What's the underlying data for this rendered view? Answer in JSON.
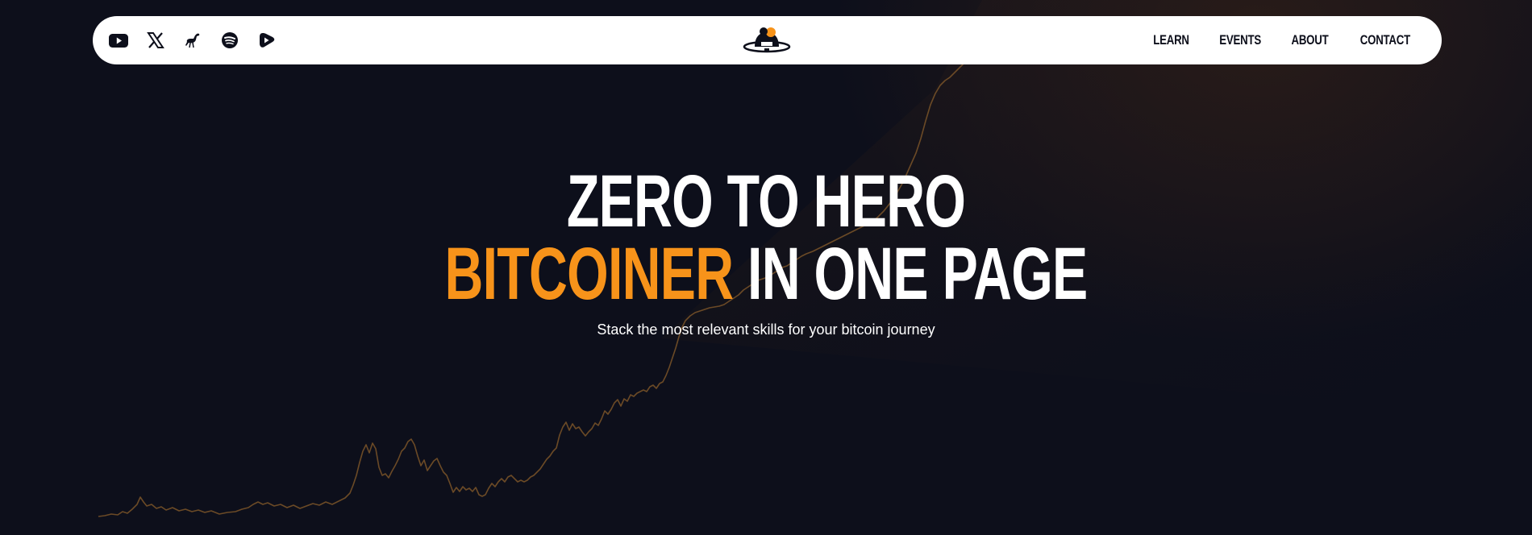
{
  "nav": {
    "social": [
      {
        "name": "youtube-icon",
        "label": "YouTube"
      },
      {
        "name": "x-icon",
        "label": "X"
      },
      {
        "name": "nostr-ostrich-icon",
        "label": "Nostr"
      },
      {
        "name": "spotify-icon",
        "label": "Spotify"
      },
      {
        "name": "rumble-icon",
        "label": "Rumble"
      }
    ],
    "links": [
      "LEARN",
      "EVENTS",
      "ABOUT",
      "CONTACT"
    ]
  },
  "hero": {
    "line1": "ZERO TO HERO",
    "line2_accent": "BITCOINER",
    "line2_rest": " IN ONE PAGE",
    "subtitle": "Stack the most relevant skills for your bitcoin journey"
  },
  "colors": {
    "background": "#0d0f1b",
    "accent": "#f7931a",
    "nav_bg": "#ffffff",
    "nav_text": "#0d0f1b",
    "chart_line": "#6b4a26"
  }
}
